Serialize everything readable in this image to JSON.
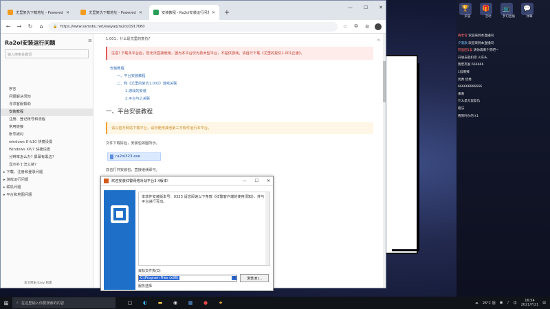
{
  "browser": {
    "tabs": [
      {
        "title": "尤里复仇下载地址 - Powered by",
        "active": false,
        "favicon": "orange"
      },
      {
        "title": "尤里复仇下载地址 - Powered by",
        "active": false,
        "favicon": "orange"
      },
      {
        "title": "安装教程 - Ra2ol安装运行问题",
        "active": true,
        "favicon": "green"
      }
    ],
    "new_tab": "+",
    "window_controls": {
      "minimize": "—",
      "maximize": "☐",
      "close": "✕"
    },
    "nav": {
      "back": "←",
      "forward": "→",
      "refresh": "↻",
      "home": "⌂"
    },
    "address": "https://www.samsbu.net/easyaq/ra2ol/1917060",
    "toolbar_icons": [
      "star-icon",
      "collections-icon",
      "extensions-icon",
      "profile-icon"
    ]
  },
  "sidebar": {
    "title": "Ra2ol安装运行问题",
    "search_placeholder": "输入搜索关键词",
    "items": [
      {
        "label": "序言",
        "active": false,
        "group": false
      },
      {
        "label": "问题解决须知",
        "active": false,
        "group": false
      },
      {
        "label": "寻求客服帮助",
        "active": false,
        "group": false
      },
      {
        "label": "安装教程",
        "active": true,
        "group": false
      },
      {
        "label": "注册、登记账号和流程",
        "active": false,
        "group": false
      },
      {
        "label": "常用链接",
        "active": false,
        "group": false
      },
      {
        "label": "账号被封",
        "active": false,
        "group": false
      },
      {
        "label": "windows 8 &10 快捷设置",
        "active": false,
        "group": false
      },
      {
        "label": "Windows XP/7 快捷设置",
        "active": false,
        "group": false
      },
      {
        "label": "分辨率怎么办? 屏幕有黑边?",
        "active": false,
        "group": false
      },
      {
        "label": "显示补丁怎么装?",
        "active": false,
        "group": false
      },
      {
        "label": "▸ 下载、注册和登录问题",
        "active": false,
        "group": true
      },
      {
        "label": "▸ 游戏运行问题",
        "active": false,
        "group": true
      },
      {
        "label": "▸ 联机问题",
        "active": false,
        "group": true
      },
      {
        "label": "▸ 平台和地图问题",
        "active": false,
        "group": true
      }
    ],
    "footer": "本文档由 Easy 构建"
  },
  "content": {
    "intro": "1.001，什么是尤里的复仇?",
    "warning": "注意! 下载本平台后，您无法直接使用，因为本平台仅为技术型平台，不提供游戏。请自行下载《尤里的复仇1.001正版》。",
    "toc": [
      {
        "label": "安装教程",
        "level": 1
      },
      {
        "label": "一、平台安装教程",
        "level": 2
      },
      {
        "label": "二、和《尤里的复仇1.001》游戏关联",
        "level": 2
      },
      {
        "label": "1.游戏的安装",
        "level": 3
      },
      {
        "label": "2.平台与之关联",
        "level": 3
      }
    ],
    "section_title": "一、平台安装教程",
    "tip": "请以官方网站下载平台，请勿使用其他第三方软件运行本平台。",
    "download_text": "文件下载好后，安装包如图所示。",
    "file_name": "ra2ol323.exe",
    "after_text": "双击打开安装包，直接继续即可。"
  },
  "dialog": {
    "title": "欢迎安装红警网络对战平台3.4版本!",
    "window_controls": {
      "minimize": "—",
      "maximize": "☐",
      "close": "✕"
    },
    "body": "本软件安装版本号：0323 请您阅读以下条款《红警客户端的使用须知》，并与平台进行互动。",
    "folder_label": "目标文件夹(D)",
    "path": "C:\\Program Files (x86)",
    "browse": "浏览(B)...",
    "option": "服务选择"
  },
  "stream": {
    "top_items": [
      {
        "icon": "🏆",
        "caption": "荣誉"
      },
      {
        "icon": "🎁",
        "caption": "活动"
      },
      {
        "icon": "📺",
        "caption": "梦幻直播"
      },
      {
        "icon": "💬",
        "caption": "弹幕"
      }
    ],
    "messages": [
      {
        "badge": "",
        "user": "赛老雪",
        "text": "欢迎来到本直播间"
      },
      {
        "badge": "",
        "user": "夕落旗",
        "text": "欢迎来到本直播间"
      },
      {
        "badge": "",
        "user": "阿里国1复",
        "text": "请你再来个赞吧~"
      },
      {
        "badge": "",
        "user": "",
        "text": "开进去就扣得 火车头"
      },
      {
        "badge": "",
        "user": "",
        "text": "我宏杰发 666666"
      },
      {
        "badge": "",
        "user": "",
        "text": "1剪啊辣"
      },
      {
        "badge": "",
        "user": "",
        "text": "优秀 优秀"
      },
      {
        "badge": "",
        "user": "",
        "text": "666666666666"
      },
      {
        "badge": "",
        "user": "",
        "text": ""
      },
      {
        "badge": "",
        "user": "",
        "text": "来来"
      },
      {
        "badge": "",
        "user": "",
        "text": "什么是尤里复仇"
      },
      {
        "badge": "",
        "user": "",
        "text": "看法"
      },
      {
        "badge": "",
        "user": "",
        "text": "看到时尔的 k1"
      }
    ]
  },
  "taskbar": {
    "search_placeholder": "在这里输入你要搜索的内容",
    "apps": [
      "task-view-icon",
      "edge-icon",
      "explorer-icon",
      "chrome-icon",
      "store-icon",
      "game-icon",
      "red-alert-icon"
    ],
    "weather": "26°C 阴",
    "lang": "中",
    "time": "16:54",
    "date": "2021/7/21"
  }
}
